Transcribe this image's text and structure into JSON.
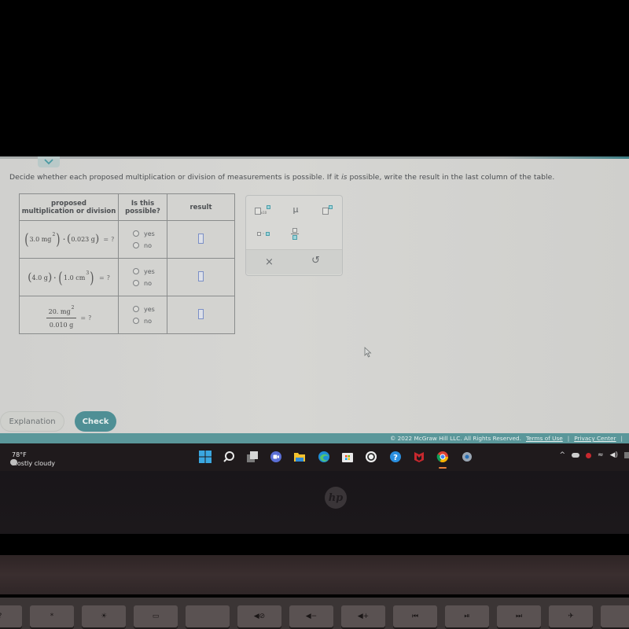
{
  "instructions": {
    "before": "Decide whether each proposed multiplication or division of measurements is possible. If it ",
    "emphasis": "is",
    "after": " possible, write the result in the last column of the table."
  },
  "table": {
    "headers": [
      "proposed multiplication or division",
      "Is this possible?",
      "result"
    ],
    "header_lines": {
      "col1_line1": "proposed",
      "col1_line2": "multiplication or division",
      "col2_line1": "Is this",
      "col2_line2": "possible?",
      "col3": "result"
    },
    "rows": [
      {
        "expression": "(3.0 mg²)·(0.023 g) = ?",
        "parts": {
          "a_value": "3.0 mg",
          "a_exp": "2",
          "b_value": "0.023 g",
          "eq": "=",
          "q": "?"
        },
        "options": [
          "yes",
          "no"
        ],
        "selected": null,
        "result": ""
      },
      {
        "expression": "(4.0 g)·(1.0 cm³) = ?",
        "parts": {
          "a_value": "4.0 g",
          "b_value": "1.0 cm",
          "b_exp": "3",
          "eq": "=",
          "q": "?"
        },
        "options": [
          "yes",
          "no"
        ],
        "selected": null,
        "result": ""
      },
      {
        "expression": "20. mg² / 0.010 g = ?",
        "parts": {
          "num_value": "20. mg",
          "num_exp": "2",
          "den_value": "0.010 g",
          "eq": "=",
          "q": "?"
        },
        "options": [
          "yes",
          "no"
        ],
        "selected": null,
        "result": ""
      }
    ]
  },
  "palette": {
    "buttons": [
      "x10-exponent",
      "mu",
      "superscript",
      "multiply-dot",
      "fraction"
    ],
    "mu_label": "μ",
    "x10_label": "x10",
    "clear_label": "×",
    "undo_label": "↺"
  },
  "actions": {
    "explanation": "Explanation",
    "check": "Check"
  },
  "footer": {
    "copyright": "© 2022 McGraw Hill LLC. All Rights Reserved.",
    "terms": "Terms of Use",
    "privacy": "Privacy Center"
  },
  "taskbar": {
    "weather_temp": "78°F",
    "weather_desc": "Mostly cloudy",
    "apps": [
      "start",
      "search",
      "task-view",
      "teams-chat",
      "file-explorer",
      "edge",
      "microsoft-store",
      "app",
      "get-help",
      "mcafee",
      "chrome",
      "settings"
    ]
  },
  "laptop": {
    "logo": "hp"
  },
  "colors": {
    "accent_teal": "#4f8f95",
    "footer_teal": "#5a979a",
    "answer_box_border": "#7b8fc6"
  }
}
